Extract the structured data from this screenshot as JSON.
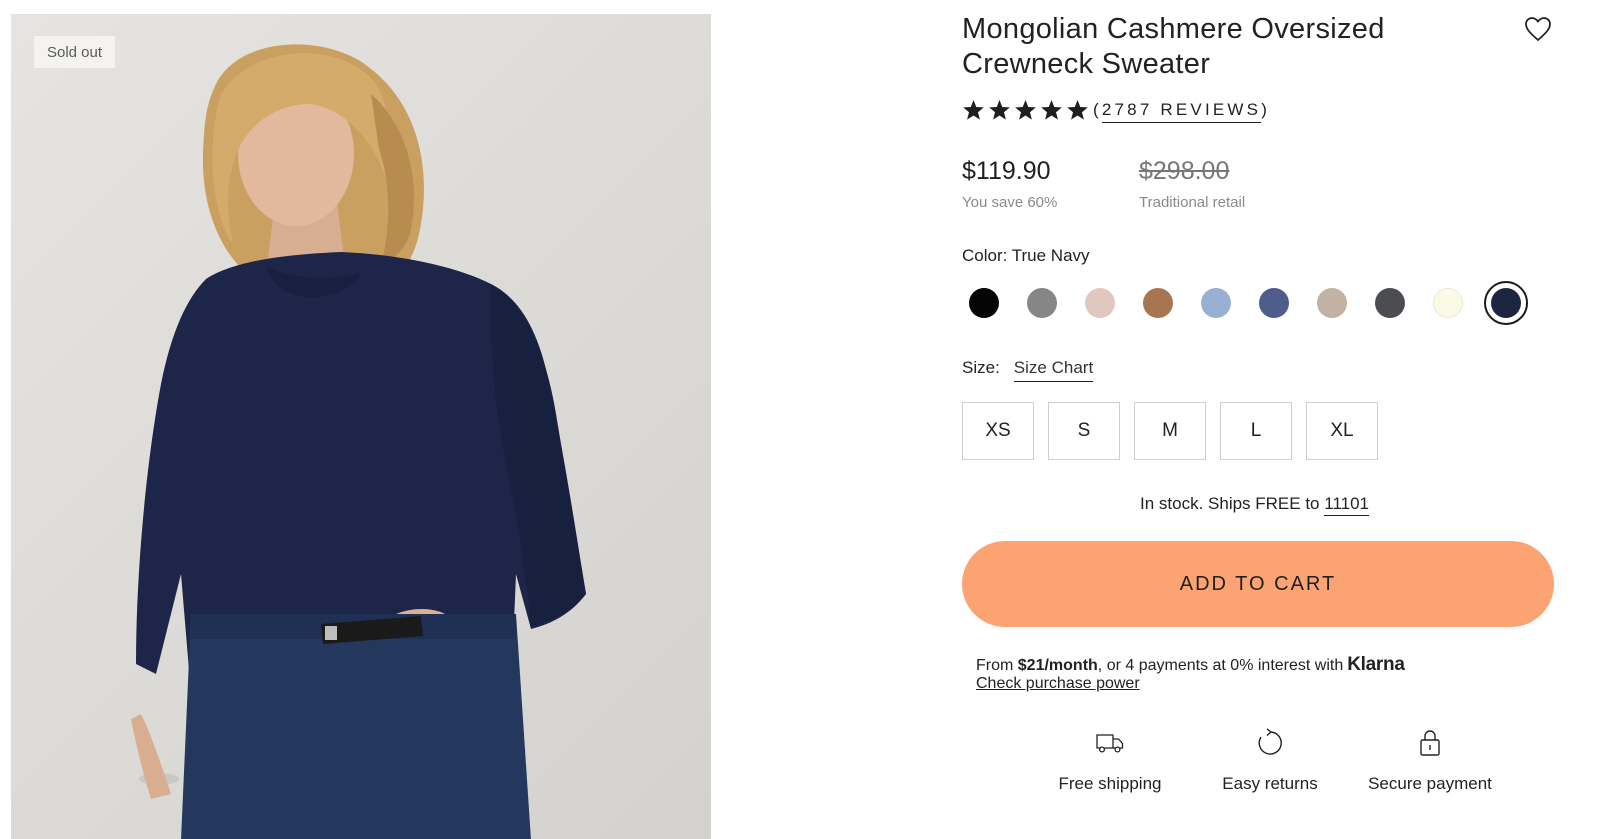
{
  "image": {
    "badge": "Sold out"
  },
  "product": {
    "title": "Mongolian Cashmere Oversized Crewneck Sweater",
    "rating_stars": 5,
    "reviews_open": "(",
    "reviews_label": "2787 REVIEWS",
    "reviews_close": ")"
  },
  "price": {
    "sale": "$119.90",
    "sale_note": "You save 60%",
    "original": "$298.00",
    "original_note": "Traditional retail"
  },
  "color": {
    "label": "Color: True Navy",
    "swatches": [
      {
        "name": "black",
        "hex": "#050505"
      },
      {
        "name": "grey",
        "hex": "#868686"
      },
      {
        "name": "blush",
        "hex": "#e1c8bf"
      },
      {
        "name": "camel",
        "hex": "#a77650"
      },
      {
        "name": "light-blue",
        "hex": "#98b1d3"
      },
      {
        "name": "indigo",
        "hex": "#4f5d8d"
      },
      {
        "name": "oatmeal",
        "hex": "#c2b2a3"
      },
      {
        "name": "charcoal",
        "hex": "#4c4d51"
      },
      {
        "name": "ivory",
        "hex": "#fafae6"
      },
      {
        "name": "true-navy",
        "hex": "#1c2640",
        "selected": true
      }
    ]
  },
  "size": {
    "label": "Size:",
    "chart_link": "Size Chart",
    "options": [
      "XS",
      "S",
      "M",
      "L",
      "XL"
    ]
  },
  "stock": {
    "text": "In stock. Ships FREE to ",
    "zip": "11101"
  },
  "cart": {
    "button_label": "ADD TO CART",
    "accent": "#fca373"
  },
  "klarna": {
    "prefix": "From ",
    "amount": "$21/month",
    "suffix": ", or 4 payments at 0% interest with",
    "brand": "Klarna",
    "link": "Check purchase power"
  },
  "features": [
    {
      "icon": "truck-icon",
      "label": "Free shipping"
    },
    {
      "icon": "returns-icon",
      "label": "Easy returns"
    },
    {
      "icon": "lock-icon",
      "label": "Secure payment"
    }
  ]
}
